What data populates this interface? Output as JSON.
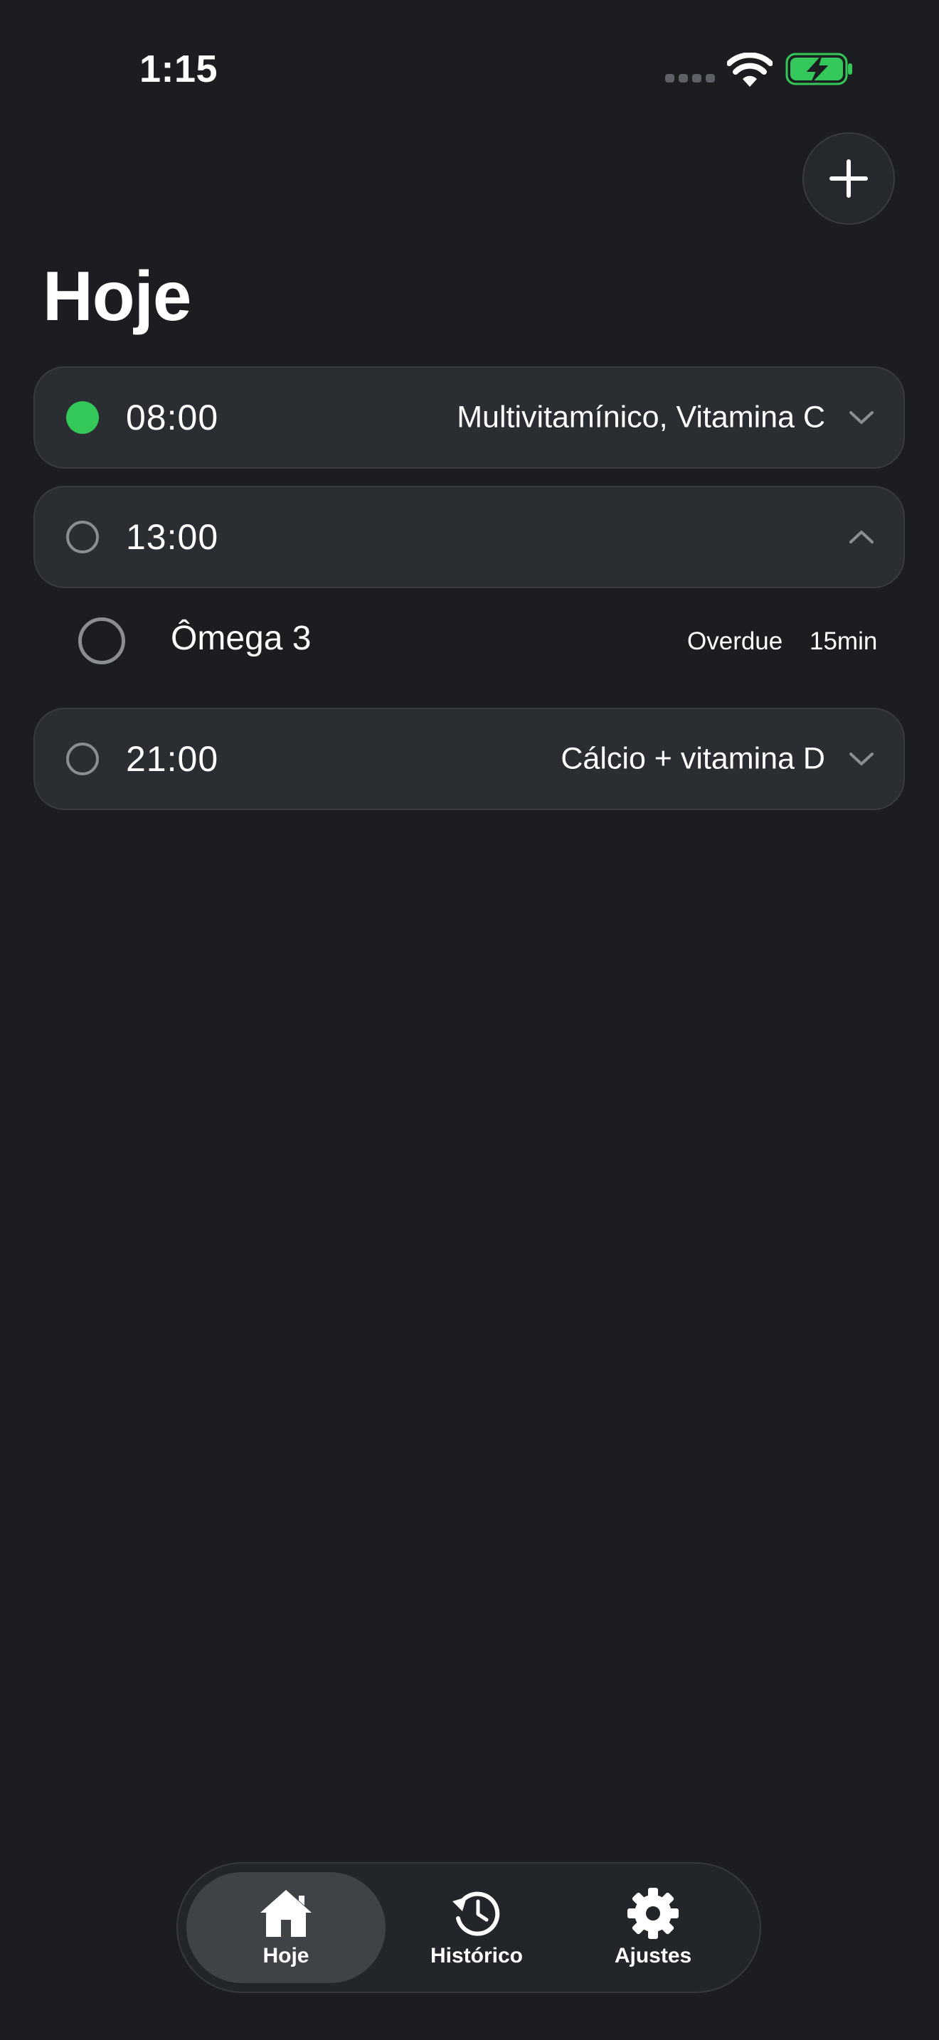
{
  "status_bar": {
    "time": "1:15"
  },
  "header": {
    "title": "Hoje",
    "add_icon": "plus-icon"
  },
  "doses": [
    {
      "time": "08:00",
      "medications": "Multivitamínico, Vitamina C",
      "status": "done",
      "expanded": false
    },
    {
      "time": "13:00",
      "medications": "",
      "status": "pending",
      "expanded": true,
      "items": [
        {
          "name": "Ômega 3",
          "status": "Overdue",
          "time_left": "15min"
        }
      ]
    },
    {
      "time": "21:00",
      "medications": "Cálcio + vitamina D",
      "status": "pending",
      "expanded": false
    }
  ],
  "tab_bar": {
    "tabs": [
      {
        "label": "Hoje",
        "icon": "house-icon",
        "active": true
      },
      {
        "label": "Histórico",
        "icon": "history-clock-icon",
        "active": false
      },
      {
        "label": "Ajustes",
        "icon": "gear-icon",
        "active": false
      }
    ]
  },
  "colors": {
    "background": "#1b1d20",
    "row_background": "#2a2d31",
    "done_green": "#34c759",
    "pending_ring": "#8a8d92",
    "battery_green": "#34c759"
  }
}
